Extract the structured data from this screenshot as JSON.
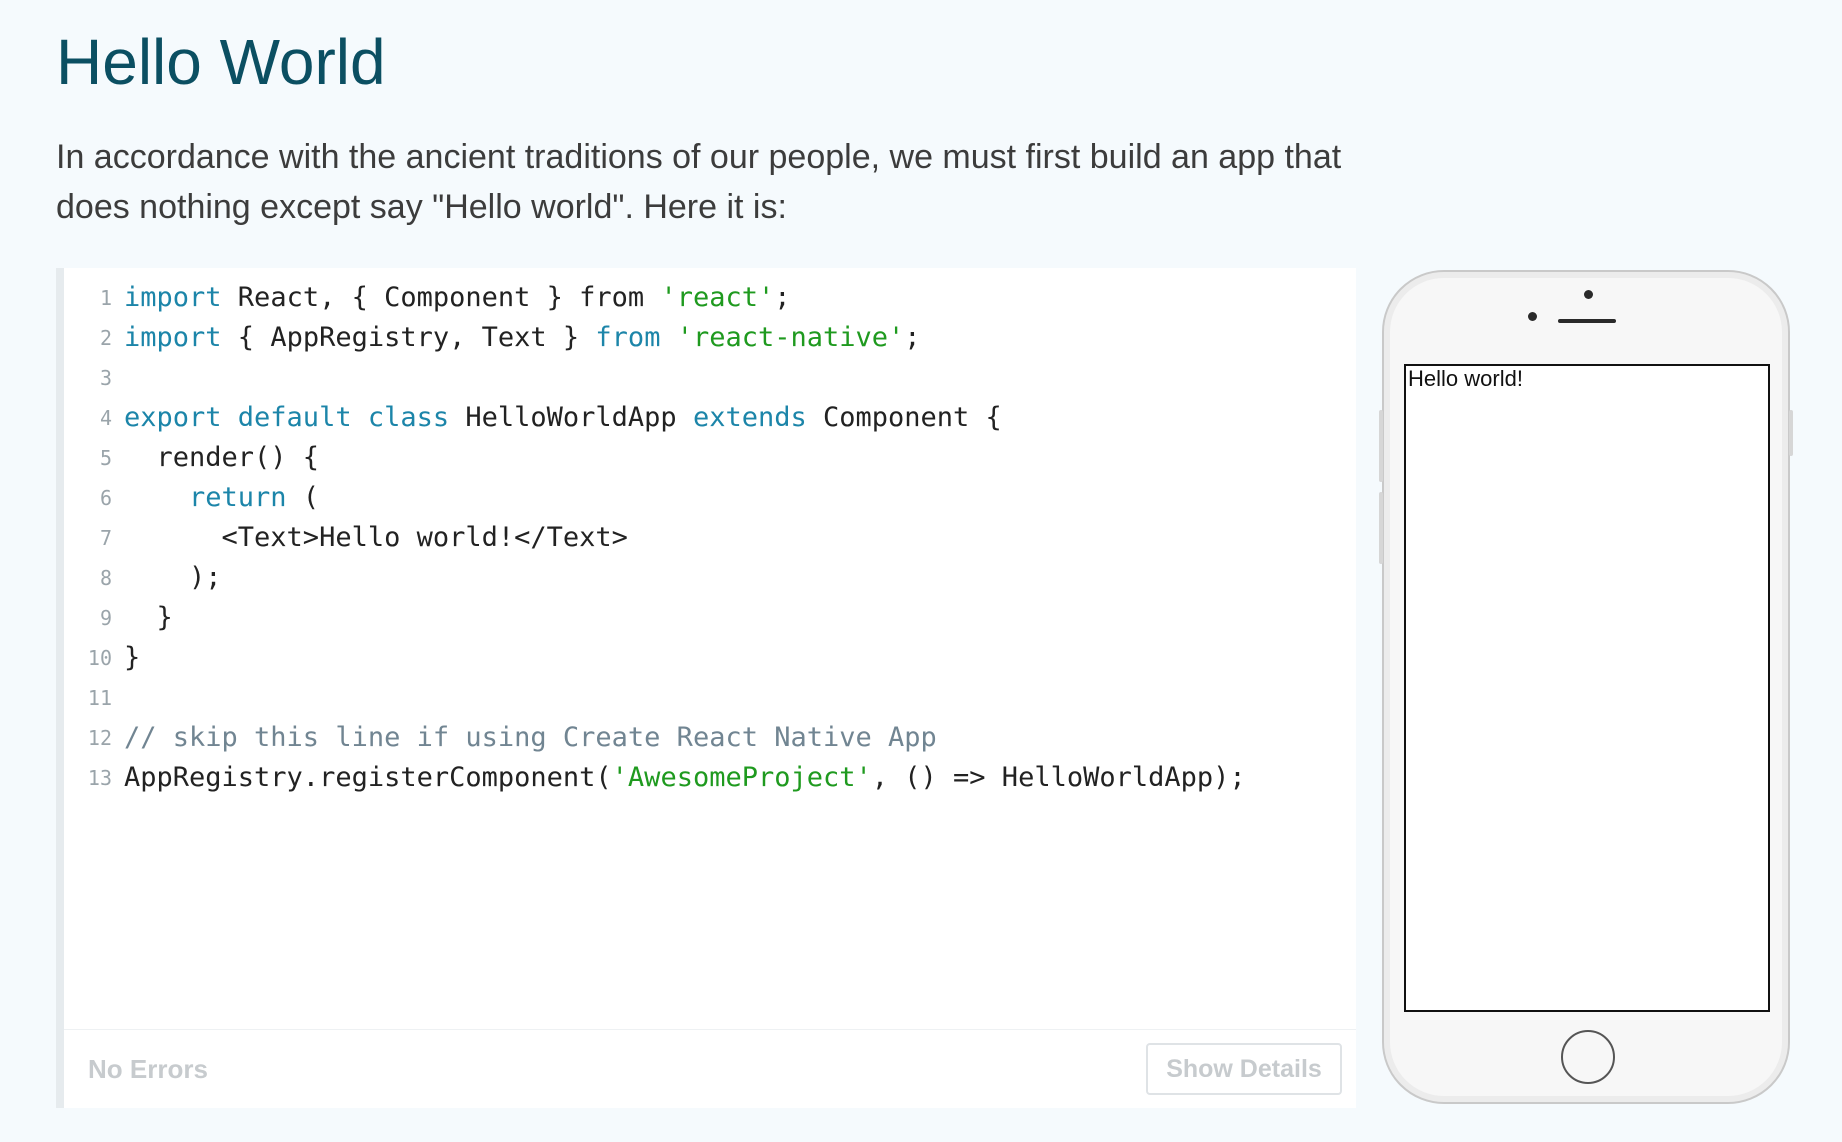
{
  "page": {
    "title": "Hello World",
    "intro": "In accordance with the ancient traditions of our people, we must first build an app that does nothing except say \"Hello world\". Here it is:"
  },
  "editor": {
    "lines": [
      {
        "num": "1",
        "tokens": [
          {
            "t": "import",
            "c": "kw"
          },
          {
            "t": " React, { Component } from ",
            "c": ""
          },
          {
            "t": "'react'",
            "c": "str"
          },
          {
            "t": ";",
            "c": ""
          }
        ]
      },
      {
        "num": "2",
        "tokens": [
          {
            "t": "import",
            "c": "kw"
          },
          {
            "t": " { AppRegistry, Text } ",
            "c": ""
          },
          {
            "t": "from",
            "c": "kw"
          },
          {
            "t": " ",
            "c": ""
          },
          {
            "t": "'react-native'",
            "c": "str"
          },
          {
            "t": ";",
            "c": ""
          }
        ]
      },
      {
        "num": "3",
        "tokens": []
      },
      {
        "num": "4",
        "tokens": [
          {
            "t": "export default class",
            "c": "kw"
          },
          {
            "t": " HelloWorldApp ",
            "c": ""
          },
          {
            "t": "extends",
            "c": "kw"
          },
          {
            "t": " Component {",
            "c": ""
          }
        ]
      },
      {
        "num": "5",
        "tokens": [
          {
            "t": "  render() {",
            "c": ""
          }
        ]
      },
      {
        "num": "6",
        "tokens": [
          {
            "t": "    ",
            "c": ""
          },
          {
            "t": "return",
            "c": "kw"
          },
          {
            "t": " (",
            "c": ""
          }
        ]
      },
      {
        "num": "7",
        "tokens": [
          {
            "t": "      <Text>Hello world!</Text>",
            "c": ""
          }
        ]
      },
      {
        "num": "8",
        "tokens": [
          {
            "t": "    );",
            "c": ""
          }
        ]
      },
      {
        "num": "9",
        "tokens": [
          {
            "t": "  }",
            "c": ""
          }
        ]
      },
      {
        "num": "10",
        "tokens": [
          {
            "t": "}",
            "c": ""
          }
        ]
      },
      {
        "num": "11",
        "tokens": []
      },
      {
        "num": "12",
        "tokens": [
          {
            "t": "// skip this line if using Create React Native App",
            "c": "cm"
          }
        ]
      },
      {
        "num": "13",
        "tokens": [
          {
            "t": "AppRegistry.registerComponent(",
            "c": ""
          },
          {
            "t": "'AwesomeProject'",
            "c": "str"
          },
          {
            "t": ", () => HelloWorldApp);",
            "c": ""
          }
        ]
      }
    ],
    "status": "No Errors",
    "details_button": "Show Details"
  },
  "simulator": {
    "screen_text": "Hello world!"
  },
  "colors": {
    "title": "#0b4f62",
    "keyword": "#1c85a9",
    "string": "#1f9a1f",
    "comment": "#718592",
    "background": "#f5fafd"
  }
}
